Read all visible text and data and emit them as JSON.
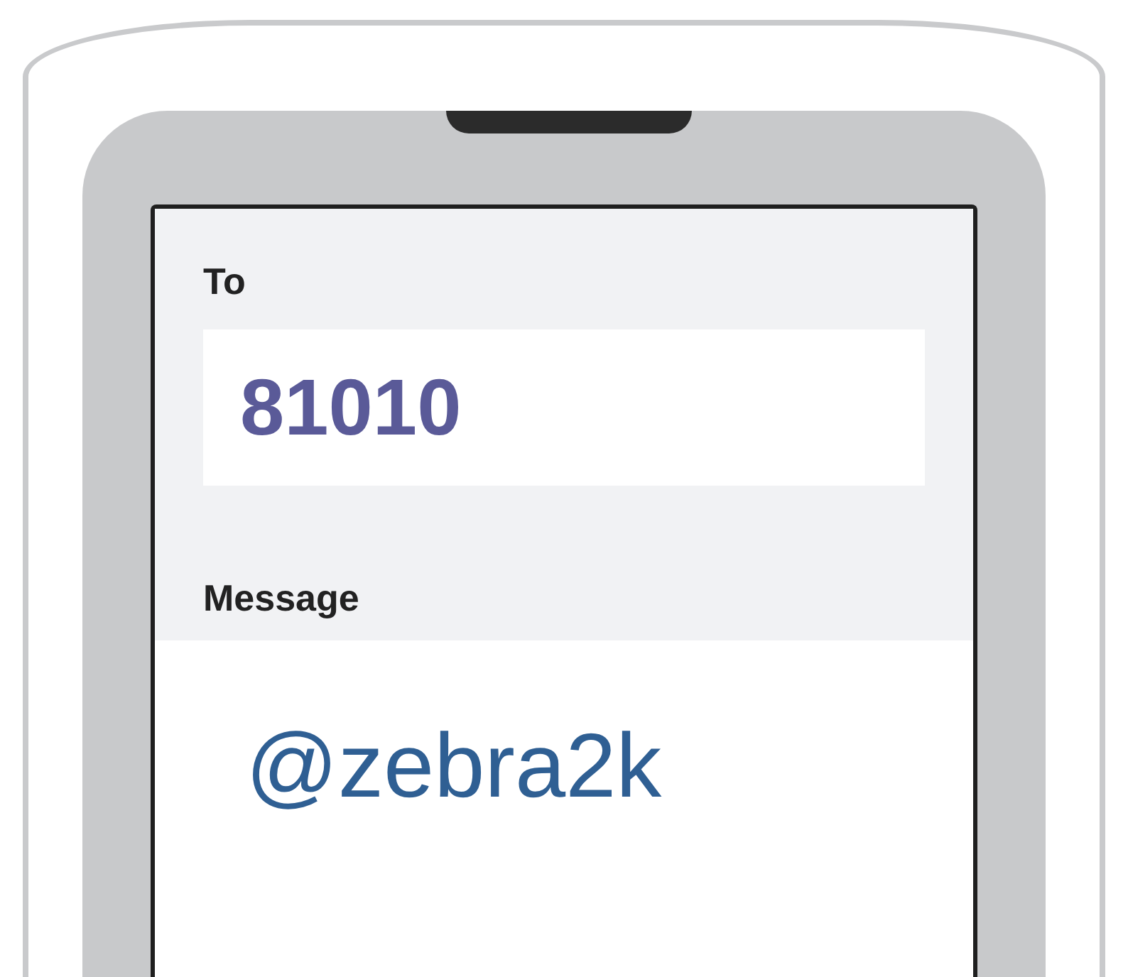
{
  "screen": {
    "to_field": {
      "label": "To",
      "value": "81010"
    },
    "message_field": {
      "label": "Message",
      "value": "@zebra2k"
    }
  }
}
